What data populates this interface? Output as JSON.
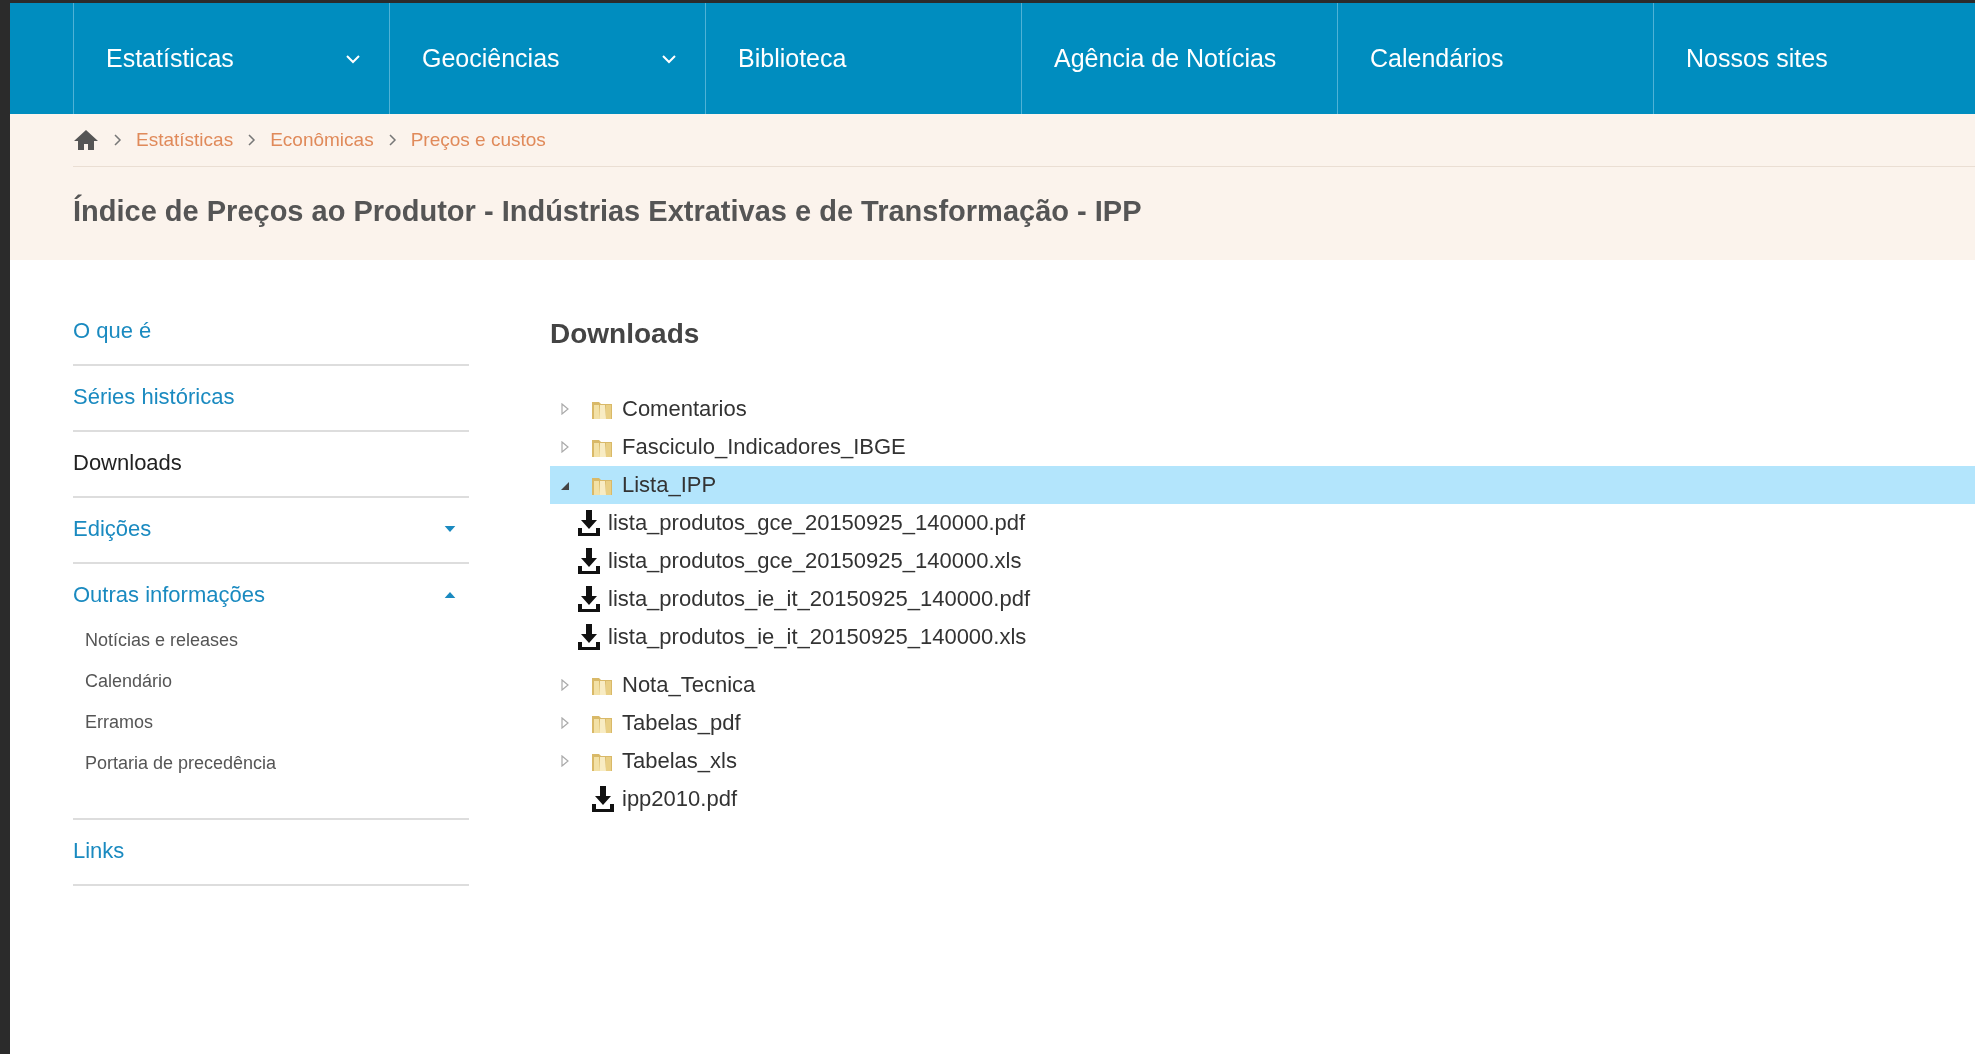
{
  "nav": [
    {
      "label": "Estatísticas",
      "kind": "dropdown"
    },
    {
      "label": "Geociências",
      "kind": "dropdown"
    },
    {
      "label": "Biblioteca",
      "kind": "link"
    },
    {
      "label": "Agência de Notícias",
      "kind": "link"
    },
    {
      "label": "Calendários",
      "kind": "link"
    },
    {
      "label": "Nossos sites",
      "kind": "link"
    }
  ],
  "breadcrumb": [
    "Estatísticas",
    "Econômicas",
    "Preços e custos"
  ],
  "page_title": "Índice de Preços ao Produtor - Indústrias Extrativas e de Transformação - IPP",
  "sidebar": [
    {
      "label": "O que é",
      "kind": "link",
      "selected": false
    },
    {
      "label": "Séries históricas",
      "kind": "link",
      "selected": false
    },
    {
      "label": "Downloads",
      "kind": "link",
      "selected": true
    },
    {
      "label": "Edições",
      "kind": "group",
      "selected": false,
      "expanded": false
    },
    {
      "label": "Outras informações",
      "kind": "group",
      "selected": false,
      "expanded": true,
      "children": [
        "Notícias e releases",
        "Calendário",
        "Erramos",
        "Portaria de precedência"
      ]
    },
    {
      "label": "Links",
      "kind": "link",
      "selected": false
    }
  ],
  "downloads": {
    "heading": "Downloads",
    "tree": [
      {
        "label": "Comentarios",
        "kind": "folder",
        "expanded": false,
        "selected": false
      },
      {
        "label": "Fasciculo_Indicadores_IBGE",
        "kind": "folder",
        "expanded": false,
        "selected": false
      },
      {
        "label": "Lista_IPP",
        "kind": "folder",
        "expanded": true,
        "selected": true,
        "children": [
          {
            "label": "lista_produtos_gce_20150925_140000.pdf",
            "kind": "file",
            "selected": false
          },
          {
            "label": "lista_produtos_gce_20150925_140000.xls",
            "kind": "file",
            "selected": false
          },
          {
            "label": "lista_produtos_ie_it_20150925_140000.pdf",
            "kind": "file",
            "selected": false
          },
          {
            "label": "lista_produtos_ie_it_20150925_140000.xls",
            "kind": "file",
            "selected": false
          }
        ]
      },
      {
        "label": "Nota_Tecnica",
        "kind": "folder",
        "expanded": false,
        "selected": false
      },
      {
        "label": "Tabelas_pdf",
        "kind": "folder",
        "expanded": false,
        "selected": false
      },
      {
        "label": "Tabelas_xls",
        "kind": "folder",
        "expanded": false,
        "selected": false
      },
      {
        "label": "ipp2010.pdf",
        "kind": "file",
        "selected": false
      }
    ]
  }
}
